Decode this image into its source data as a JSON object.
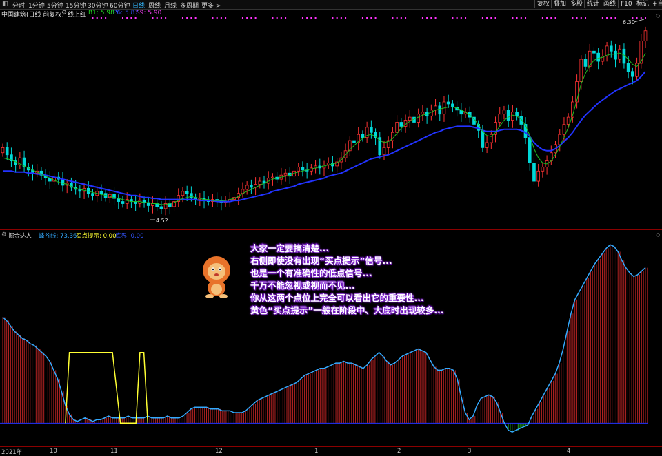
{
  "toolbar": {
    "tabs": [
      "分时",
      "1分钟",
      "5分钟",
      "15分钟",
      "30分钟",
      "60分钟",
      "日线",
      "周线",
      "月线",
      "多周期",
      "更多 >"
    ],
    "active_tab": "日线",
    "right_buttons": [
      "复权",
      "叠加",
      "多股",
      "统计",
      "画线",
      "F10",
      "标记",
      "+自"
    ]
  },
  "header": {
    "stock_title": "中国建筑(日线 前复权)",
    "indicator_name": "线上红",
    "b1_label": "B1: 5.98",
    "p6_label": "P6: 5.87",
    "s9_label": "S9: 5.90",
    "price_high_marker": "6.30",
    "price_low_marker": "4.52"
  },
  "indicator_panel": {
    "name": "掘金达人",
    "line1": "峰谷线: 73.36",
    "line2": "买点提示: 0.00",
    "line3": "底界: 0.00"
  },
  "annotation": {
    "lines": [
      "大家一定要搞清楚...",
      "右侧即使没有出现“买点提示”信号...",
      "也是一个有准确性的低点信号...",
      "千万不能忽视或视而不见...",
      "你从这两个点位上完全可以看出它的重要性...",
      "黄色“买点提示”一般在阶段中、大底时出现较多..."
    ]
  },
  "date_axis": [
    "2021年",
    "10",
    "11",
    "12",
    "1",
    "2",
    "3",
    "4"
  ],
  "colors": {
    "up": "#ff3333",
    "down": "#00d8d8",
    "ma_fast": "#22c022",
    "ma_slow": "#2233ff",
    "osc": "#33aaff",
    "buy": "#ffff33",
    "bars_up": "#b22222",
    "bars_down": "#22aa22",
    "signal_dots": "#ff33ff",
    "panel_border": "#8b0000"
  },
  "chart_data": [
    {
      "type": "candlestick",
      "price_range": [
        4.4,
        6.4
      ],
      "high_label": 6.3,
      "low_label": 4.52,
      "closes": [
        5.15,
        5.08,
        5.02,
        4.98,
        5.05,
        4.96,
        4.93,
        4.9,
        4.92,
        4.88,
        4.85,
        4.82,
        4.86,
        4.84,
        4.78,
        4.8,
        4.76,
        4.74,
        4.72,
        4.75,
        4.7,
        4.68,
        4.72,
        4.7,
        4.66,
        4.69,
        4.65,
        4.62,
        4.6,
        4.64,
        4.62,
        4.6,
        4.63,
        4.61,
        4.58,
        4.6,
        4.57,
        4.55,
        4.6,
        4.57,
        4.62,
        4.68,
        4.72,
        4.7,
        4.66,
        4.64,
        4.65,
        4.63,
        4.62,
        4.64,
        4.63,
        4.61,
        4.62,
        4.64,
        4.66,
        4.7,
        4.74,
        4.78,
        4.76,
        4.79,
        4.82,
        4.8,
        4.85,
        4.86,
        4.84,
        4.88,
        4.9,
        4.87,
        4.92,
        4.96,
        4.93,
        4.92,
        4.95,
        4.97,
        4.95,
        4.98,
        5.0,
        4.97,
        5.01,
        5.05,
        5.12,
        5.22,
        5.2,
        5.28,
        5.25,
        5.35,
        5.3,
        5.25,
        5.08,
        5.15,
        5.22,
        5.3,
        5.4,
        5.36,
        5.42,
        5.45,
        5.4,
        5.48,
        5.5,
        5.46,
        5.52,
        5.56,
        5.48,
        5.6,
        5.58,
        5.55,
        5.52,
        5.48,
        5.5,
        5.45,
        5.38,
        5.32,
        5.15,
        5.2,
        5.28,
        5.4,
        5.48,
        5.52,
        5.42,
        5.5,
        5.46,
        5.38,
        5.25,
        5.0,
        4.82,
        4.92,
        4.96,
        5.02,
        5.1,
        5.18,
        5.28,
        5.38,
        5.45,
        5.6,
        5.8,
        6.02,
        5.95,
        6.1,
        6.08,
        6.0,
        6.05,
        6.15,
        6.1,
        6.02,
        6.12,
        5.98,
        5.9,
        5.85,
        5.98,
        6.2,
        6.3
      ],
      "ma_fast": [
        5.05,
        5.04,
        5.03,
        5.01,
        4.99,
        4.97,
        4.95,
        4.93,
        4.91,
        4.89,
        4.87,
        4.85,
        4.83,
        4.81,
        4.8,
        4.79,
        4.77,
        4.75,
        4.74,
        4.73,
        4.72,
        4.71,
        4.7,
        4.69,
        4.68,
        4.67,
        4.66,
        4.65,
        4.64,
        4.63,
        4.62,
        4.62,
        4.62,
        4.61,
        4.61,
        4.6,
        4.6,
        4.59,
        4.59,
        4.6,
        4.61,
        4.63,
        4.65,
        4.66,
        4.67,
        4.66,
        4.65,
        4.64,
        4.64,
        4.63,
        4.63,
        4.63,
        4.63,
        4.64,
        4.65,
        4.67,
        4.7,
        4.72,
        4.74,
        4.76,
        4.78,
        4.8,
        4.82,
        4.84,
        4.85,
        4.86,
        4.87,
        4.88,
        4.9,
        4.91,
        4.92,
        4.93,
        4.94,
        4.95,
        4.96,
        4.97,
        4.98,
        4.99,
        5.0,
        5.03,
        5.08,
        5.13,
        5.17,
        5.21,
        5.24,
        5.27,
        5.28,
        5.26,
        5.22,
        5.2,
        5.21,
        5.24,
        5.29,
        5.34,
        5.38,
        5.41,
        5.43,
        5.45,
        5.47,
        5.48,
        5.5,
        5.52,
        5.53,
        5.54,
        5.55,
        5.55,
        5.54,
        5.52,
        5.5,
        5.47,
        5.43,
        5.38,
        5.31,
        5.27,
        5.26,
        5.3,
        5.36,
        5.42,
        5.45,
        5.47,
        5.46,
        5.43,
        5.37,
        5.27,
        5.14,
        5.05,
        5.0,
        4.99,
        5.02,
        5.08,
        5.16,
        5.25,
        5.35,
        5.47,
        5.62,
        5.78,
        5.88,
        5.96,
        6.01,
        6.03,
        6.04,
        6.06,
        6.07,
        6.07,
        6.08,
        6.06,
        6.02,
        5.97,
        5.95,
        6.0,
        6.08
      ],
      "ma_slow": [
        4.92,
        4.92,
        4.92,
        4.91,
        4.91,
        4.91,
        4.9,
        4.9,
        4.89,
        4.89,
        4.88,
        4.87,
        4.86,
        4.85,
        4.84,
        4.83,
        4.82,
        4.81,
        4.8,
        4.79,
        4.78,
        4.77,
        4.76,
        4.75,
        4.74,
        4.73,
        4.72,
        4.71,
        4.7,
        4.69,
        4.68,
        4.68,
        4.67,
        4.66,
        4.66,
        4.65,
        4.65,
        4.64,
        4.64,
        4.64,
        4.64,
        4.64,
        4.64,
        4.64,
        4.64,
        4.64,
        4.63,
        4.63,
        4.63,
        4.63,
        4.62,
        4.62,
        4.62,
        4.62,
        4.63,
        4.63,
        4.64,
        4.65,
        4.66,
        4.67,
        4.68,
        4.69,
        4.7,
        4.72,
        4.73,
        4.74,
        4.75,
        4.76,
        4.77,
        4.79,
        4.8,
        4.81,
        4.82,
        4.83,
        4.84,
        4.85,
        4.87,
        4.88,
        4.89,
        4.9,
        4.92,
        4.94,
        4.96,
        4.98,
        5.0,
        5.02,
        5.04,
        5.05,
        5.06,
        5.07,
        5.08,
        5.1,
        5.12,
        5.14,
        5.16,
        5.18,
        5.2,
        5.22,
        5.24,
        5.26,
        5.28,
        5.3,
        5.31,
        5.33,
        5.34,
        5.35,
        5.36,
        5.36,
        5.36,
        5.36,
        5.35,
        5.34,
        5.32,
        5.31,
        5.31,
        5.31,
        5.32,
        5.33,
        5.33,
        5.33,
        5.33,
        5.32,
        5.3,
        5.26,
        5.2,
        5.16,
        5.13,
        5.12,
        5.12,
        5.14,
        5.17,
        5.21,
        5.25,
        5.3,
        5.36,
        5.42,
        5.47,
        5.51,
        5.55,
        5.59,
        5.62,
        5.65,
        5.68,
        5.71,
        5.73,
        5.75,
        5.77,
        5.79,
        5.81,
        5.85,
        5.9
      ]
    },
    {
      "type": "area",
      "series_name": "峰谷线",
      "y_range": [
        -10,
        105
      ],
      "values": [
        60,
        58,
        55,
        52,
        50,
        48,
        47,
        45,
        44,
        42,
        40,
        38,
        35,
        30,
        25,
        18,
        10,
        5,
        2,
        1,
        2,
        3,
        2,
        1,
        2,
        2,
        3,
        4,
        3,
        3,
        3,
        3,
        4,
        3,
        3,
        3,
        3,
        4,
        3,
        3,
        3,
        3,
        4,
        3,
        3,
        3,
        4,
        6,
        8,
        9,
        9,
        9,
        9,
        8,
        8,
        8,
        7,
        7,
        7,
        6,
        6,
        6,
        7,
        9,
        11,
        13,
        14,
        15,
        16,
        17,
        18,
        19,
        20,
        21,
        22,
        23,
        25,
        27,
        28,
        29,
        30,
        31,
        31,
        32,
        33,
        34,
        34,
        35,
        34,
        34,
        33,
        32,
        31,
        33,
        36,
        38,
        40,
        38,
        35,
        33,
        34,
        36,
        38,
        39,
        40,
        41,
        42,
        41,
        40,
        36,
        32,
        30,
        30,
        31,
        31,
        30,
        25,
        15,
        6,
        2,
        4,
        10,
        14,
        15,
        16,
        15,
        12,
        6,
        0,
        -4,
        -5,
        -4,
        -3,
        -2,
        -1,
        4,
        8,
        12,
        16,
        20,
        24,
        28,
        34,
        42,
        52,
        62,
        70,
        74,
        78,
        82,
        86,
        90,
        93,
        96,
        99,
        101,
        100,
        97,
        92,
        88,
        85,
        83,
        84,
        86,
        88
      ]
    },
    {
      "type": "line",
      "series_name": "买点提示",
      "segments": [
        {
          "start": 16,
          "peak_start": 17,
          "peak_end": 28,
          "end": 30
        },
        {
          "start": 34,
          "peak_start": 35,
          "peak_end": 36,
          "end": 37
        }
      ],
      "peak_value": 40
    }
  ]
}
